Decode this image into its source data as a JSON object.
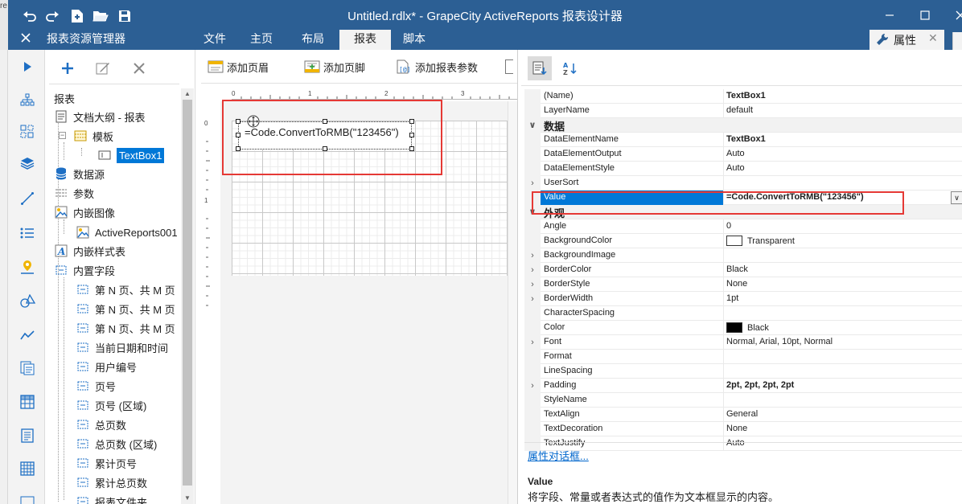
{
  "window": {
    "title": "Untitled.rdlx* - GrapeCity ActiveReports 报表设计器",
    "left_clip_text": "re",
    "colors": {
      "titlebar": "#2c5f94",
      "selection": "#0078d7",
      "highlight_box": "#e53935"
    }
  },
  "quick_access": [
    "undo-icon",
    "redo-icon",
    "new-document-icon",
    "open-folder-icon",
    "save-icon"
  ],
  "window_controls": [
    "minimize-icon",
    "maximize-icon",
    "close-icon"
  ],
  "menubar": {
    "explorer_title": "报表资源管理器",
    "tabs": [
      "文件",
      "主页",
      "布局",
      "报表",
      "脚本"
    ],
    "active_tab": "报表",
    "properties_tab": "属性"
  },
  "rail_icons": [
    "pointer-icon",
    "hierarchy-icon",
    "grid-layout-icon",
    "layers-icon",
    "line-icon",
    "list-icon",
    "map-pin-icon",
    "shapes-icon",
    "sparkline-icon",
    "subreport-icon",
    "table-icon",
    "textbox-icon",
    "matrix-icon",
    "chart-icon"
  ],
  "explorer": {
    "root": "报表",
    "nodes": [
      {
        "label": "文档大纲 - 报表",
        "icon": "document-outline-icon"
      },
      {
        "label": "模板",
        "icon": "template-icon"
      },
      {
        "label": "TextBox1",
        "icon": "textbox-item-icon"
      },
      {
        "label": "数据源",
        "icon": "database-icon"
      },
      {
        "label": "参数",
        "icon": "parameters-icon"
      },
      {
        "label": "内嵌图像",
        "icon": "image-icon"
      },
      {
        "label": "ActiveReports001",
        "icon": "image-icon"
      },
      {
        "label": "内嵌样式表",
        "icon": "stylesheet-icon"
      },
      {
        "label": "内置字段",
        "icon": "fields-icon"
      },
      {
        "label": "第 N 页、共 M 页",
        "icon": "field-icon"
      },
      {
        "label": "第 N 页、共 M 页",
        "icon": "field-icon"
      },
      {
        "label": "第 N 页、共 M 页",
        "icon": "field-icon"
      },
      {
        "label": "当前日期和时间",
        "icon": "field-icon"
      },
      {
        "label": "用户编号",
        "icon": "field-icon"
      },
      {
        "label": "页号",
        "icon": "field-icon"
      },
      {
        "label": "页号 (区域)",
        "icon": "field-icon"
      },
      {
        "label": "总页数",
        "icon": "field-icon"
      },
      {
        "label": "总页数 (区域)",
        "icon": "field-icon"
      },
      {
        "label": "累计页号",
        "icon": "field-icon"
      },
      {
        "label": "累计总页数",
        "icon": "field-icon"
      },
      {
        "label": "报表文件夹",
        "icon": "field-icon"
      }
    ]
  },
  "designer": {
    "toolbar": [
      "添加页眉",
      "添加页脚",
      "添加报表参数"
    ],
    "ruler_h": [
      "0",
      "1",
      "2",
      "3"
    ],
    "ruler_v": [
      "0",
      "1"
    ],
    "textbox_value": "=Code.ConvertToRMB(\"123456\")"
  },
  "properties": {
    "rows": [
      {
        "type": "prop",
        "name": "(Name)",
        "value": "TextBox1",
        "bold": true
      },
      {
        "type": "prop",
        "name": "LayerName",
        "value": "default"
      },
      {
        "type": "cat",
        "name": "数据",
        "glyph": "∨"
      },
      {
        "type": "prop",
        "name": "DataElementName",
        "value": "TextBox1",
        "bold": true
      },
      {
        "type": "prop",
        "name": "DataElementOutput",
        "value": "Auto"
      },
      {
        "type": "prop",
        "name": "DataElementStyle",
        "value": "Auto"
      },
      {
        "type": "prop",
        "name": "UserSort",
        "value": "",
        "glyph": "›"
      },
      {
        "type": "sel",
        "name": "Value",
        "value": "=Code.ConvertToRMB(\"123456\")",
        "bold": true
      },
      {
        "type": "cat",
        "name": "外观",
        "glyph": "∨"
      },
      {
        "type": "prop",
        "name": "Angle",
        "value": "0"
      },
      {
        "type": "prop",
        "name": "BackgroundColor",
        "value": "Transparent",
        "swatch": "#ffffff"
      },
      {
        "type": "prop",
        "name": "BackgroundImage",
        "value": "",
        "glyph": "›"
      },
      {
        "type": "prop",
        "name": "BorderColor",
        "value": "Black",
        "glyph": "›"
      },
      {
        "type": "prop",
        "name": "BorderStyle",
        "value": "None",
        "glyph": "›"
      },
      {
        "type": "prop",
        "name": "BorderWidth",
        "value": "1pt",
        "glyph": "›"
      },
      {
        "type": "prop",
        "name": "CharacterSpacing",
        "value": ""
      },
      {
        "type": "prop",
        "name": "Color",
        "value": "Black",
        "swatch": "#000000"
      },
      {
        "type": "prop",
        "name": "Font",
        "value": "Normal, Arial, 10pt, Normal",
        "glyph": "›"
      },
      {
        "type": "prop",
        "name": "Format",
        "value": ""
      },
      {
        "type": "prop",
        "name": "LineSpacing",
        "value": ""
      },
      {
        "type": "prop",
        "name": "Padding",
        "value": "2pt, 2pt, 2pt, 2pt",
        "bold": true,
        "glyph": "›"
      },
      {
        "type": "prop",
        "name": "StyleName",
        "value": ""
      },
      {
        "type": "prop",
        "name": "TextAlign",
        "value": "General"
      },
      {
        "type": "prop",
        "name": "TextDecoration",
        "value": "None"
      },
      {
        "type": "prop",
        "name": "TextJustify",
        "value": "Auto"
      }
    ],
    "link": "属性对话框...",
    "desc_title": "Value",
    "desc": "将字段、常量或者表达式的值作为文本框显示的内容。"
  }
}
